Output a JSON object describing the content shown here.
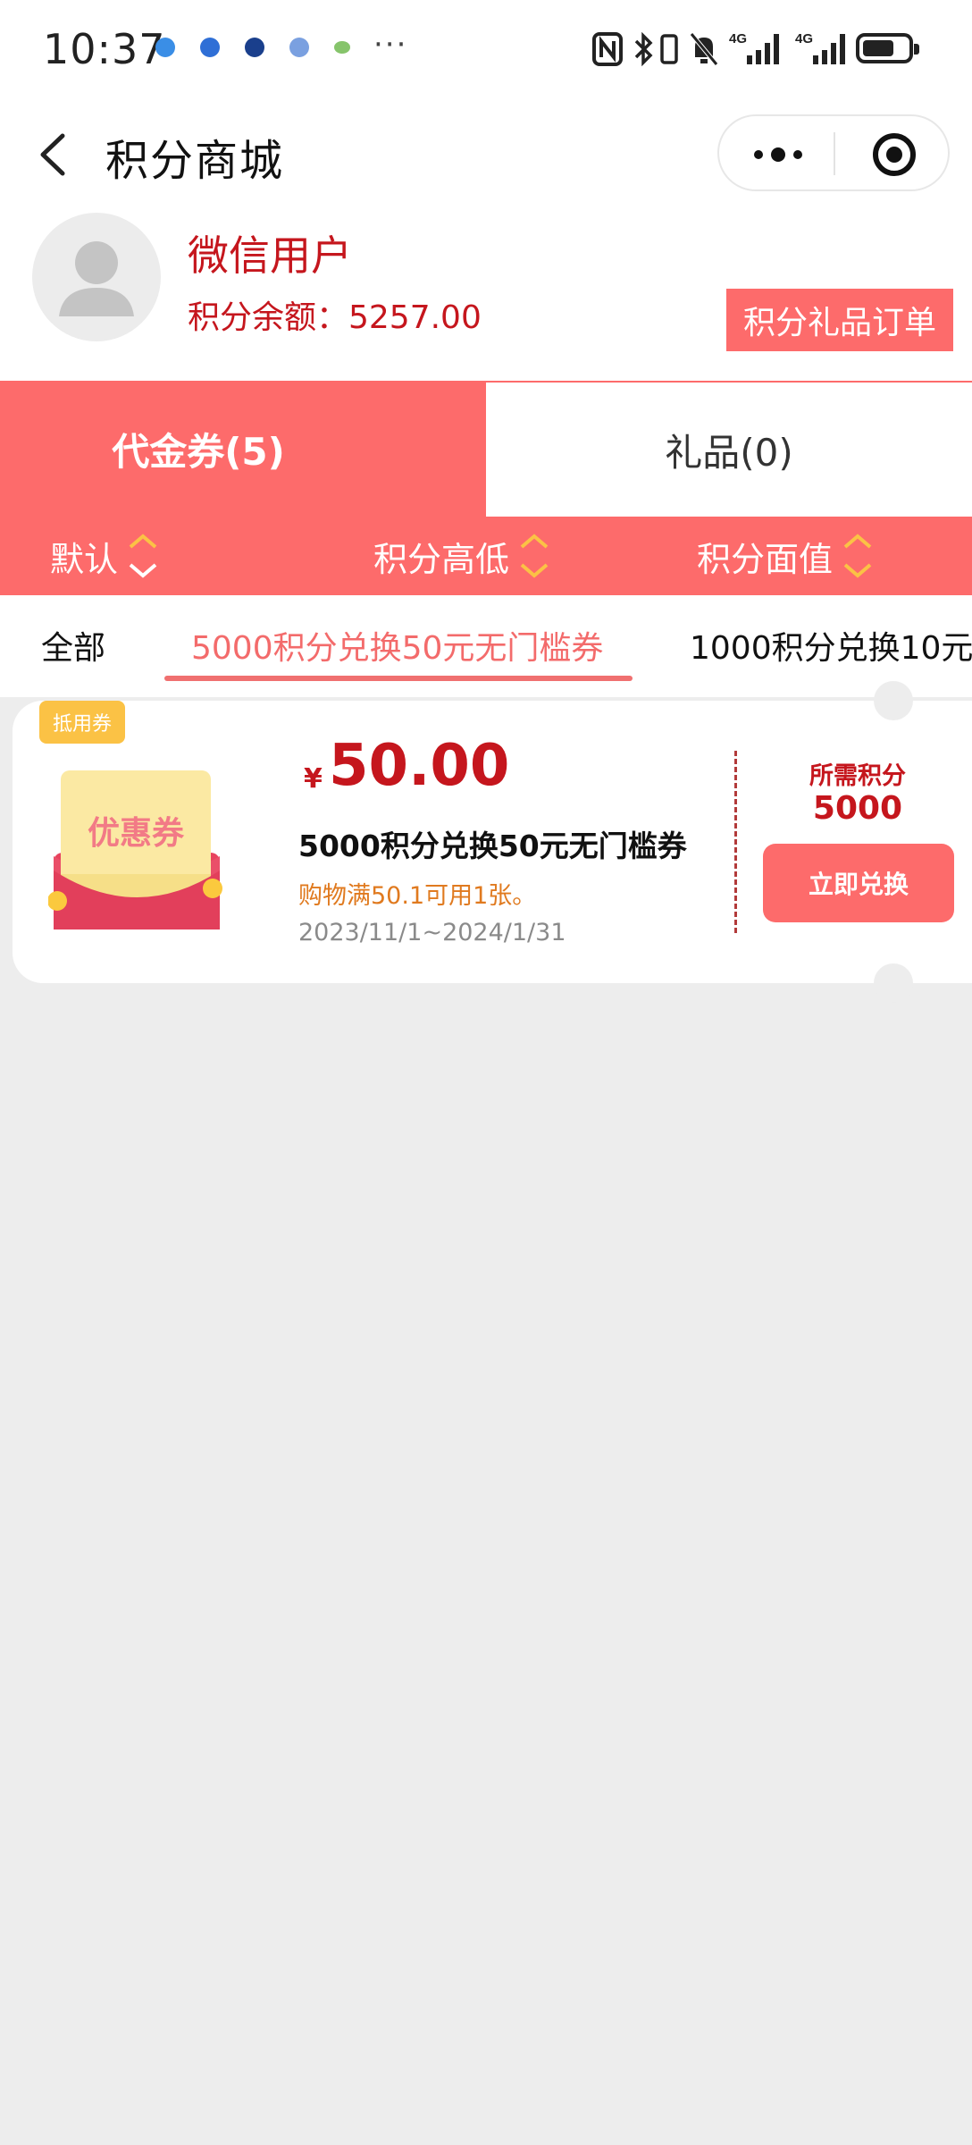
{
  "status_bar": {
    "time": "10:37",
    "more_indicator": "···",
    "icons": [
      "nfc-icon",
      "bluetooth-icon",
      "vibrate-icon",
      "mute-bell-icon",
      "signal-4g-icon",
      "signal-4g-icon",
      "battery-icon"
    ],
    "battery_level": 0.6
  },
  "nav": {
    "title": "积分商城"
  },
  "user": {
    "name": "微信用户",
    "balance": "积分余额：5257.00",
    "orders_button": "积分礼品订单"
  },
  "tabs": [
    {
      "label": "代金券(5)",
      "active": true
    },
    {
      "label": "礼品(0)",
      "active": false
    }
  ],
  "sort": [
    {
      "label": "默认"
    },
    {
      "label": "积分高低"
    },
    {
      "label": "积分面值"
    }
  ],
  "filters": {
    "all": "全部",
    "active": "5000积分兑换50元无门槛券",
    "other": "1000积分兑换10元"
  },
  "coupon": {
    "tag": "抵用券",
    "image_text": "优惠券",
    "currency": "¥",
    "amount": "50.00",
    "name": "5000积分兑换50元无门槛券",
    "condition": "购物满50.1可用1张。",
    "dates": "2023/11/1~2024/1/31",
    "points_label": "所需积分",
    "points_value": "5000",
    "redeem_button": "立即兑换"
  },
  "colors": {
    "brand": "#fd6b6b",
    "price_red": "#c5161d",
    "tag_yellow": "#fbc245",
    "condition_orange": "#e07a1f",
    "background": "#ededed"
  }
}
